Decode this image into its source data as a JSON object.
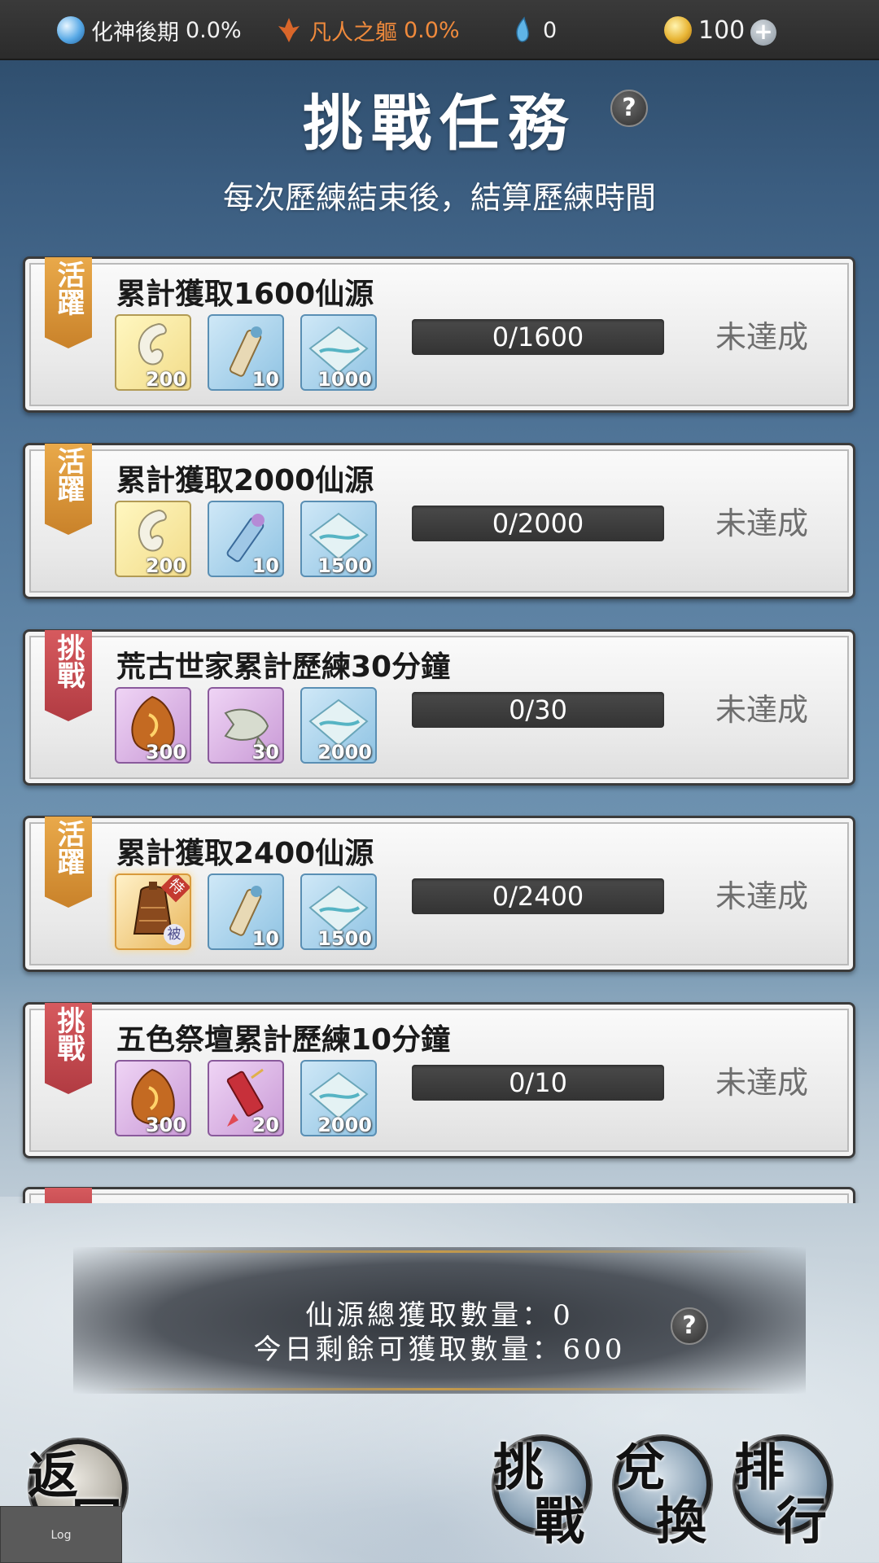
{
  "topbar": {
    "realm": {
      "label": "化神後期",
      "value": "0.0%",
      "icon": "yinyang-icon"
    },
    "body": {
      "label": "凡人之軀",
      "value": "0.0%",
      "icon": "flame-sigil-icon"
    },
    "spirit": {
      "value": "0",
      "icon": "crystal-drop-icon"
    },
    "coins": {
      "value": "100",
      "icon": "gold-coin-icon"
    },
    "add_label": "+"
  },
  "header": {
    "title": "挑戰任務",
    "help_label": "?",
    "subtitle": "每次歷練結束後，結算歷練時間"
  },
  "quests": [
    {
      "tag": "活躍",
      "tag_type": "active",
      "title": "累計獲取1600仙源",
      "rewards": [
        {
          "item": "white-jade-icon",
          "qty": "200",
          "frame": "gold"
        },
        {
          "item": "scroll-icon",
          "qty": "10",
          "frame": "blue"
        },
        {
          "item": "cloth-icon",
          "qty": "1000",
          "frame": "blue"
        }
      ],
      "progress": "0/1600",
      "status": "未達成"
    },
    {
      "tag": "活躍",
      "tag_type": "active",
      "title": "累計獲取2000仙源",
      "rewards": [
        {
          "item": "white-jade-icon",
          "qty": "200",
          "frame": "gold"
        },
        {
          "item": "blue-scroll-icon",
          "qty": "10",
          "frame": "blue"
        },
        {
          "item": "cloth-icon",
          "qty": "1500",
          "frame": "blue"
        }
      ],
      "progress": "0/2000",
      "status": "未達成"
    },
    {
      "tag": "挑戰",
      "tag_type": "challenge",
      "title": "荒古世家累計歷練30分鐘",
      "rewards": [
        {
          "item": "ember-stone-icon",
          "qty": "300",
          "frame": "purple"
        },
        {
          "item": "fish-charm-icon",
          "qty": "30",
          "frame": "purple"
        },
        {
          "item": "cloth-icon",
          "qty": "2000",
          "frame": "blue"
        }
      ],
      "progress": "0/30",
      "status": "未達成"
    },
    {
      "tag": "活躍",
      "tag_type": "active",
      "title": "累計獲取2400仙源",
      "rewards": [
        {
          "item": "bronze-bell-icon",
          "qty": "",
          "frame": "special",
          "badge_top": "特",
          "badge_bottom": "被"
        },
        {
          "item": "scroll-icon",
          "qty": "10",
          "frame": "blue"
        },
        {
          "item": "cloth-icon",
          "qty": "1500",
          "frame": "blue"
        }
      ],
      "progress": "0/2400",
      "status": "未達成"
    },
    {
      "tag": "挑戰",
      "tag_type": "challenge",
      "title": "五色祭壇累計歷練10分鐘",
      "rewards": [
        {
          "item": "ember-stone-icon",
          "qty": "300",
          "frame": "purple"
        },
        {
          "item": "red-talisman-icon",
          "qty": "20",
          "frame": "purple"
        },
        {
          "item": "cloth-icon",
          "qty": "2000",
          "frame": "blue"
        }
      ],
      "progress": "0/10",
      "status": "未達成"
    }
  ],
  "summary": {
    "total_line": "仙源總獲取數量：0",
    "remaining_line": "今日剩餘可獲取數量：600",
    "help_label": "?"
  },
  "buttons": {
    "back": [
      "返",
      "回"
    ],
    "challenge": [
      "挑",
      "戰"
    ],
    "exchange": [
      "兌",
      "換"
    ],
    "ranking": [
      "排",
      "行"
    ],
    "log": "Log"
  }
}
